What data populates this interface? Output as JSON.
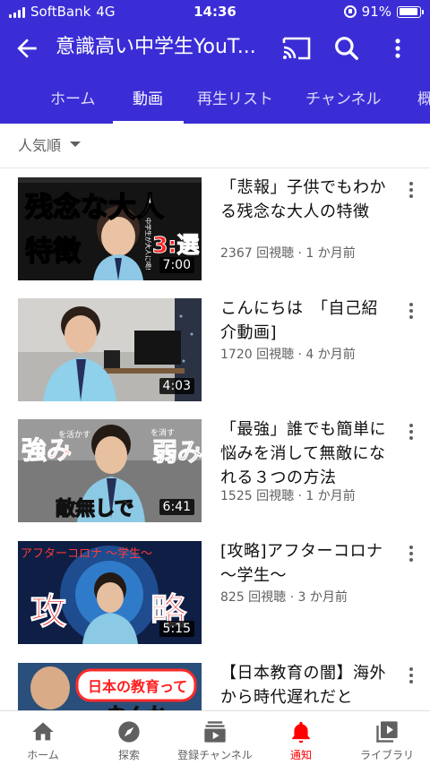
{
  "status_bar": {
    "carrier": "SoftBank",
    "network": "4G",
    "time": "14:36",
    "battery": "91%",
    "battery_level": 0.91
  },
  "header": {
    "title": "意識高い中学生YouT...",
    "tabs": [
      {
        "label": "ホーム",
        "active": false
      },
      {
        "label": "動画",
        "active": true
      },
      {
        "label": "再生リスト",
        "active": false
      },
      {
        "label": "チャンネル",
        "active": false
      },
      {
        "label": "概",
        "active": false
      }
    ]
  },
  "sort": {
    "label": "人気順"
  },
  "videos": [
    {
      "title": "「悲報」子供でもわかる残念な大人の特徴",
      "meta": "2367 回視聴 · 1 か月前",
      "duration": "7:00",
      "thumb_text": {
        "line1": "残念な大人",
        "line2": "特徴",
        "badge": "3:選",
        "side": "中学生が大人に喝!"
      }
    },
    {
      "title": "こんにちは　「自己紹介動画]",
      "meta": "1720 回視聴 · 4 か月前",
      "duration": "4:03",
      "thumb_text": {}
    },
    {
      "title": "「最強」誰でも簡単に悩みを消して無敵になれる３つの方法",
      "meta": "1525 回視聴 · 1 か月前",
      "duration": "6:41",
      "thumb_text": {
        "left": "強み",
        "left_small": "を活かす",
        "right": "弱み",
        "right_small": "を消す",
        "bottom": "敵無しで"
      }
    },
    {
      "title": "[攻略]アフターコロナ　～学生～",
      "meta": "825 回視聴 · 3 か月前",
      "duration": "5:15",
      "thumb_text": {
        "top": "アフターコロナ ～学生～",
        "left": "攻",
        "right": "略"
      }
    },
    {
      "title": "【日本教育の闇】海外から時代遅れだと",
      "meta": "",
      "duration": "",
      "thumb_text": {
        "bubble": "日本の教育って",
        "bubble2": "なんか"
      }
    }
  ],
  "bottom_nav": [
    {
      "label": "ホーム",
      "icon": "home-icon",
      "active": false
    },
    {
      "label": "探索",
      "icon": "compass-icon",
      "active": false
    },
    {
      "label": "登録チャンネル",
      "icon": "subscriptions-icon",
      "active": false
    },
    {
      "label": "通知",
      "icon": "bell-icon",
      "active": true
    },
    {
      "label": "ライブラリ",
      "icon": "library-icon",
      "active": false
    }
  ],
  "colors": {
    "header_bg": "#3b2dd6",
    "active_nav": "#ff0000",
    "text_secondary": "#606060"
  }
}
